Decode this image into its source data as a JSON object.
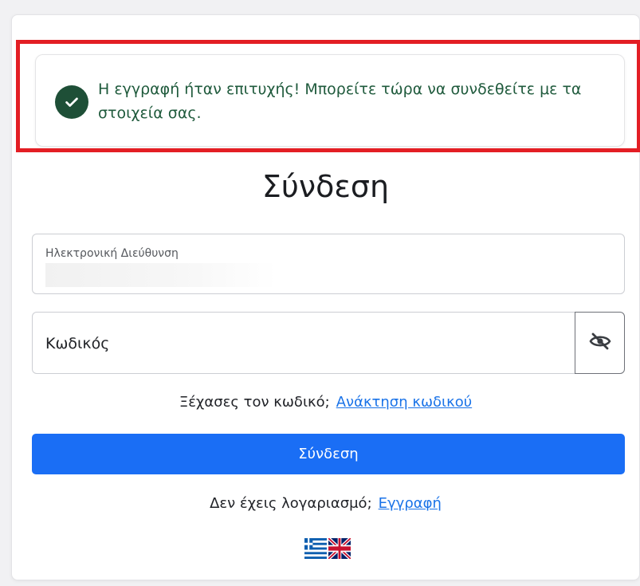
{
  "alert": {
    "icon": "check-circle-icon",
    "message": "Η εγγραφή ήταν επιτυχής! Μπορείτε τώρα να συνδεθείτε με τα στοιχεία σας.",
    "color": "#1f5a3c"
  },
  "login": {
    "title": "Σύνδεση",
    "email_label": "Ηλεκτρονική Διεύθυνση",
    "email_value": "",
    "password_placeholder": "Κωδικός",
    "password_toggle_icon": "eye-slash-icon",
    "forgot_text": "Ξέχασες τον κωδικό;",
    "forgot_link": "Ανάκτηση κωδικού",
    "submit_label": "Σύνδεση",
    "no_account_text": "Δεν έχεις λογαριασμό;",
    "register_link": "Εγγραφή"
  },
  "languages": [
    {
      "icon": "greek-flag-icon"
    },
    {
      "icon": "uk-flag-icon"
    }
  ],
  "colors": {
    "accent": "#1a6ef5",
    "link": "#1a73e8",
    "highlight_frame": "#e31e24",
    "success": "#1e4f37"
  }
}
